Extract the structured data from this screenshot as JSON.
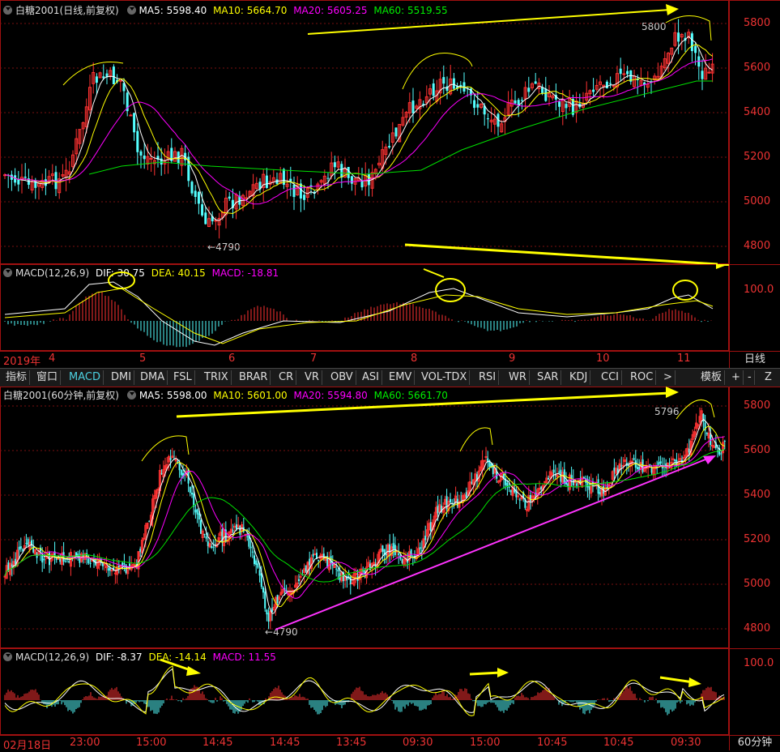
{
  "colors": {
    "up": "#ff3232",
    "down": "#54ffff",
    "ma5": "#ffffff",
    "ma10": "#ffff00",
    "ma20": "#ff00ff",
    "ma60": "#00e000",
    "border": "#a01010",
    "arrow_yellow": "#ffff00",
    "arrow_magenta": "#ff33ff"
  },
  "top": {
    "title": "白糖2001(日线,前复权)",
    "ma5": "MA5: 5598.40",
    "ma10": "MA10: 5664.70",
    "ma20": "MA20: 5605.25",
    "ma60": "MA60: 5519.55",
    "ticks": [
      "5800",
      "5600",
      "5400",
      "5200",
      "5000",
      "4800"
    ],
    "high_label": "5800",
    "low_label": "4790"
  },
  "top_macd": {
    "title": "MACD(12,26,9)",
    "dif": "DIF: 30.75",
    "dea": "DEA: 40.15",
    "macd": "MACD: -18.81",
    "tick": "100.0"
  },
  "date_axis_top": {
    "year": "2019年",
    "months": [
      "4",
      "5",
      "6",
      "7",
      "8",
      "9",
      "10",
      "11"
    ],
    "period": "日线"
  },
  "tabs": {
    "items": [
      "指标",
      "窗口",
      "MACD",
      "DMI",
      "DMA",
      "FSL",
      "TRIX",
      "BRAR",
      "CR",
      "VR",
      "OBV",
      "ASI",
      "EMV",
      "VOL-TDX",
      "RSI",
      "WR",
      "SAR",
      "KDJ",
      "CCI",
      "ROC",
      ">"
    ],
    "template": "模板",
    "plus": "+",
    "minus": "-",
    "z": "Z"
  },
  "bottom": {
    "title": "白糖2001(60分钟,前复权)",
    "ma5": "MA5: 5598.00",
    "ma10": "MA10: 5601.00",
    "ma20": "MA20: 5594.80",
    "ma60": "MA60: 5661.70",
    "ticks": [
      "5800",
      "5600",
      "5400",
      "5200",
      "5000",
      "4800"
    ],
    "high_label": "5796",
    "low_label": "4790"
  },
  "bottom_macd": {
    "title": "MACD(12,26,9)",
    "dif": "DIF: -8.37",
    "dea": "DEA: -14.14",
    "macd": "MACD: 11.55",
    "tick": "100.0"
  },
  "date_axis_bottom": {
    "labels": [
      "02月18日",
      "23:00",
      "15:00",
      "14:45",
      "14:45",
      "13:45",
      "09:30",
      "15:00",
      "10:45",
      "10:45",
      "09:30"
    ],
    "period": "60分钟"
  }
}
